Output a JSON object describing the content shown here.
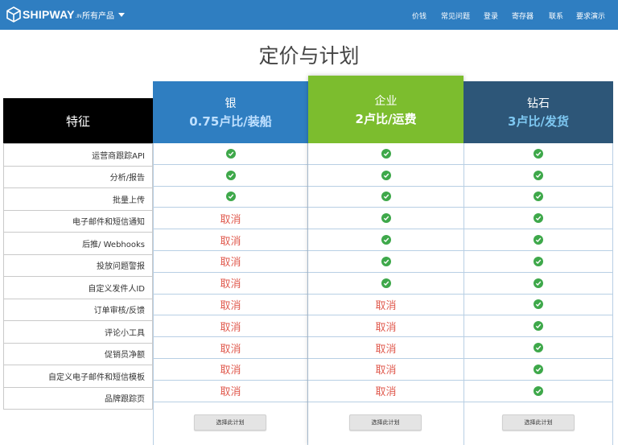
{
  "nav": {
    "logo_text": "SHIPWAY",
    "logo_suffix": ".IN",
    "products": "所有产品",
    "links": [
      "价钱",
      "常见问题",
      "登录",
      "寄存器",
      "联系",
      "要求演示"
    ]
  },
  "title": "定价与计划",
  "features": {
    "header": "特征",
    "items": [
      "运营商跟踪API",
      "分析/报告",
      "批量上传",
      "电子邮件和短信通知",
      "后推/ Webhooks",
      "投放问题警报",
      "自定义发件人ID",
      "订单审核/反馈",
      "评论小工具",
      "促销员净额",
      "自定义电子邮件和短信模板",
      "品牌跟踪页"
    ]
  },
  "plans": [
    {
      "name": "银",
      "price": "0.75卢比/装船",
      "header_color": "#2f7ec1",
      "price_color": "#bfe0ff",
      "button": "选择此计划",
      "rows": [
        "check",
        "check",
        "check",
        "取消",
        "取消",
        "取消",
        "取消",
        "取消",
        "取消",
        "取消",
        "取消",
        "取消"
      ]
    },
    {
      "name": "企业",
      "price": "2卢比/运费",
      "header_color": "#7cbd2e",
      "price_color": "#ffffff",
      "button": "选择此计划",
      "rows": [
        "check",
        "check",
        "check",
        "check",
        "check",
        "check",
        "check",
        "取消",
        "取消",
        "取消",
        "取消",
        "取消"
      ]
    },
    {
      "name": "钻石",
      "price": "3卢比/发货",
      "header_color": "#2d5678",
      "price_color": "#7ec8f2",
      "button": "选择此计划",
      "rows": [
        "check",
        "check",
        "check",
        "check",
        "check",
        "check",
        "check",
        "check",
        "check",
        "check",
        "check",
        "check"
      ]
    }
  ],
  "colors": {
    "nav_bg": "#2f7ec1",
    "check": "#3ea84a",
    "cancel": "#e05a4e"
  }
}
